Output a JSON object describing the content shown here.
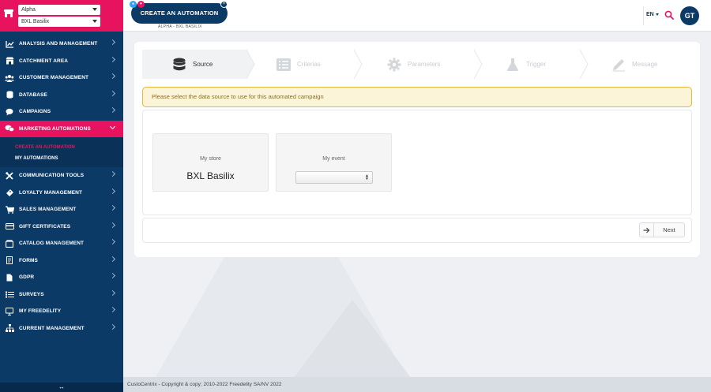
{
  "sidebar": {
    "store_select_1": "Alpha",
    "store_select_2": "BXL Basilix",
    "menu": [
      {
        "label": "ANALYSIS AND MANAGEMENT",
        "icon": "chart-line-icon"
      },
      {
        "label": "CATCHMENT AREA",
        "icon": "store-icon"
      },
      {
        "label": "CUSTOMER MANAGEMENT",
        "icon": "users-icon"
      },
      {
        "label": "DATABASE",
        "icon": "database-icon"
      },
      {
        "label": "CAMPAIGNS",
        "icon": "chat-bubble-icon"
      },
      {
        "label": "MARKETING AUTOMATIONS",
        "icon": "chat-bubbles-icon"
      }
    ],
    "submenu": [
      {
        "label": "CREATE AN AUTOMATION"
      },
      {
        "label": "MY AUTOMATIONS"
      }
    ],
    "menu2": [
      {
        "label": "COMMUNICATION TOOLS",
        "icon": "tools-icon"
      },
      {
        "label": "LOYALTY MANAGEMENT",
        "icon": "ticket-icon"
      },
      {
        "label": "SALES MANAGEMENT",
        "icon": "cart-icon"
      },
      {
        "label": "GIFT CERTIFICATES",
        "icon": "gift-card-icon"
      },
      {
        "label": "CATALOG MANAGEMENT",
        "icon": "catalog-icon"
      },
      {
        "label": "FORMS",
        "icon": "form-icon"
      },
      {
        "label": "GDPR",
        "icon": "document-icon"
      },
      {
        "label": "SURVEYS",
        "icon": "survey-icon"
      },
      {
        "label": "MY FREEDELITY",
        "icon": "monitor-icon"
      },
      {
        "label": "CURRENT MANAGEMENT",
        "icon": "sitemap-icon"
      }
    ],
    "collapse_toggle": "↔"
  },
  "header": {
    "create_button": "CREATE AN AUTOMATION",
    "breadcrumb": "ALPHA - BXL BASILIX",
    "language": "EN",
    "avatar_initials": "GT"
  },
  "wizard": {
    "steps": [
      {
        "label": "Source",
        "icon": "database-icon",
        "active": true
      },
      {
        "label": "Criterias",
        "icon": "list-icon",
        "active": false
      },
      {
        "label": "Parameters",
        "icon": "gear-icon",
        "active": false
      },
      {
        "label": "Trigger",
        "icon": "flask-icon",
        "active": false
      },
      {
        "label": "Message",
        "icon": "pencil-icon",
        "active": false
      }
    ],
    "alert": "Please select the data source to use for this automated campaign",
    "store_label": "My store",
    "store_value": "BXL Basilix",
    "event_label": "My event",
    "event_value": "",
    "next_button": "Next"
  },
  "footer": {
    "copyright": "CustoCentrix - Copyright & copy; 2010-2022 Freedelity SA/NV 2022"
  },
  "colors": {
    "navy": "#0b3a66",
    "pink": "#e8135f",
    "alert_bg": "#fcf4d9",
    "alert_border": "#e5b63d"
  }
}
